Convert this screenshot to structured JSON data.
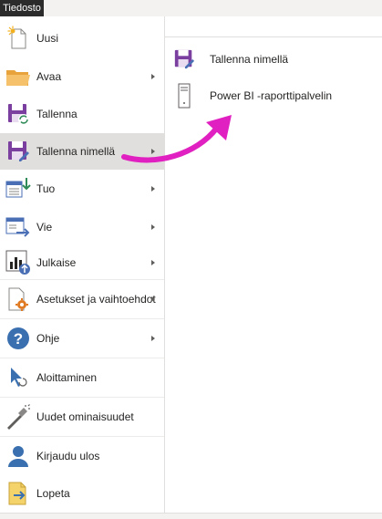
{
  "tabs": {
    "file": "Tiedosto"
  },
  "menu": {
    "items": [
      {
        "label": "Uusi",
        "icon": "new-file-icon",
        "submenu": false
      },
      {
        "label": "Avaa",
        "icon": "open-folder-icon",
        "submenu": true
      },
      {
        "label": "Tallenna",
        "icon": "save-icon",
        "submenu": false
      },
      {
        "label": "Tallenna nimellä",
        "icon": "save-as-icon",
        "submenu": true,
        "selected": true
      },
      {
        "label": "Tuo",
        "icon": "import-icon",
        "submenu": true
      },
      {
        "label": "Vie",
        "icon": "export-icon",
        "submenu": true
      },
      {
        "label": "Julkaise",
        "icon": "publish-icon",
        "submenu": true
      },
      {
        "label": "Asetukset ja vaihtoehdot",
        "icon": "settings-icon",
        "submenu": true
      },
      {
        "label": "Ohje",
        "icon": "help-icon",
        "submenu": true
      },
      {
        "label": "Aloittaminen",
        "icon": "getting-started-icon",
        "submenu": false
      },
      {
        "label": "Uudet ominaisuudet",
        "icon": "new-features-icon",
        "submenu": false
      },
      {
        "label": "Kirjaudu ulos",
        "icon": "sign-out-icon",
        "submenu": false
      },
      {
        "label": "Lopeta",
        "icon": "exit-icon",
        "submenu": false
      }
    ]
  },
  "submenu": {
    "items": [
      {
        "label": "Tallenna nimellä",
        "icon": "save-as-icon"
      },
      {
        "label": "Power BI -raporttipalvelin",
        "icon": "report-server-icon"
      }
    ]
  },
  "colors": {
    "file_tab": "#2b2b2b",
    "selected": "#e1dfdd",
    "accent_purple": "#7b3fa0",
    "callout_arrow": "#e020c0"
  }
}
